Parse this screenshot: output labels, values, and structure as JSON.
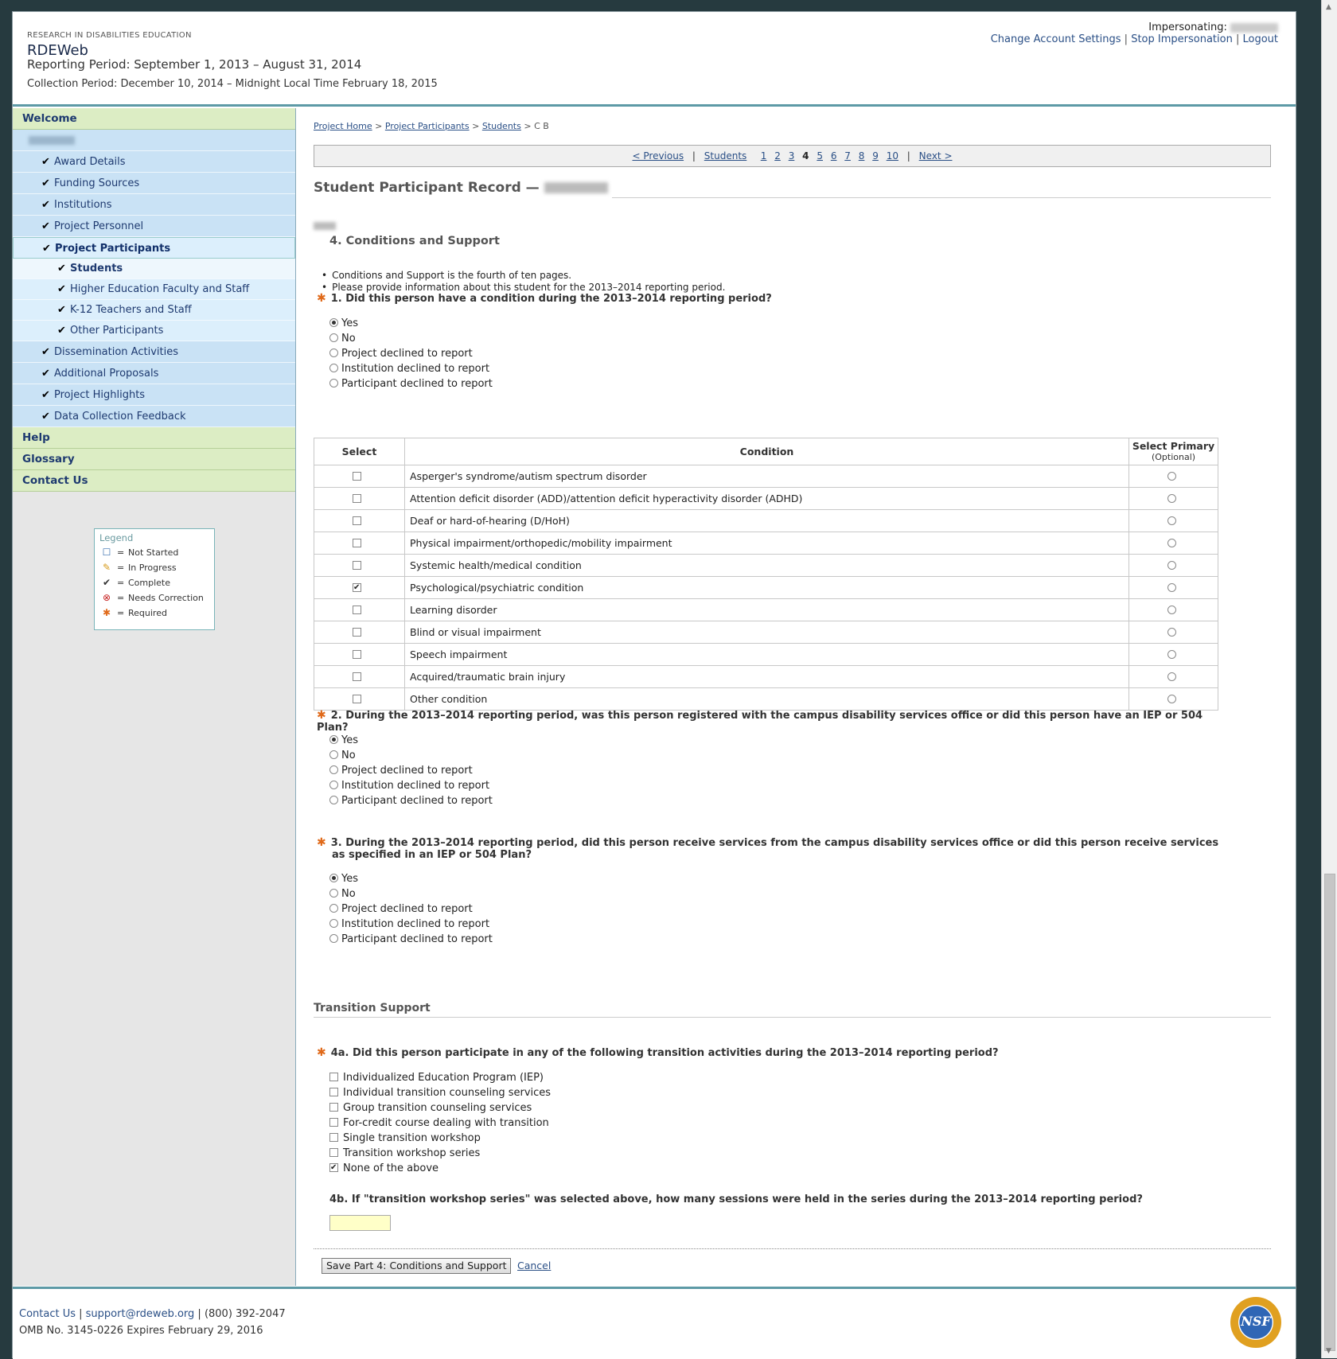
{
  "header": {
    "org": "RESEARCH IN DISABILITIES EDUCATION",
    "app_name": "RDEWeb",
    "reporting_period": "Reporting Period: September 1, 2013 – August 31, 2014",
    "collection_period": "Collection Period: December 10, 2014 – Midnight Local Time February 18, 2015",
    "impersonating_label": "Impersonating:",
    "links": {
      "change_account": "Change Account Settings",
      "stop_impersonation": "Stop Impersonation",
      "logout": "Logout"
    }
  },
  "sidebar": {
    "welcome": "Welcome",
    "items": [
      {
        "label": "Award Details"
      },
      {
        "label": "Funding Sources"
      },
      {
        "label": "Institutions"
      },
      {
        "label": "Project Personnel"
      },
      {
        "label": "Project Participants"
      }
    ],
    "subitems": [
      {
        "label": "Students"
      },
      {
        "label": "Higher Education Faculty and Staff"
      },
      {
        "label": "K-12 Teachers and Staff"
      },
      {
        "label": "Other Participants"
      }
    ],
    "items2": [
      {
        "label": "Dissemination Activities"
      },
      {
        "label": "Additional Proposals"
      },
      {
        "label": "Project Highlights"
      },
      {
        "label": "Data Collection Feedback"
      }
    ],
    "help": "Help",
    "glossary": "Glossary",
    "contact": "Contact Us",
    "check_glyph": "✔"
  },
  "legend": {
    "title": "Legend",
    "eq": "=",
    "not_started": "Not Started",
    "in_progress": "In Progress",
    "complete": "Complete",
    "needs_correction": "Needs Correction",
    "required": "Required"
  },
  "breadcrumb": {
    "home": "Project Home",
    "participants": "Project Participants",
    "students": "Students",
    "current": "C B",
    "sep": ">"
  },
  "pager": {
    "previous": "< Previous",
    "students": "Students",
    "pages": [
      "1",
      "2",
      "3",
      "4",
      "5",
      "6",
      "7",
      "8",
      "9",
      "10"
    ],
    "current_page": "4",
    "next": "Next >",
    "sep": "|"
  },
  "record": {
    "title": "Student Participant Record —",
    "section": "4. Conditions and Support",
    "bullets": [
      "Conditions and Support is the fourth of ten pages.",
      "Please provide information about this student for the 2013–2014 reporting period."
    ]
  },
  "options": {
    "yes": "Yes",
    "no": "No",
    "project_declined": "Project declined to report",
    "institution_declined": "Institution declined to report",
    "participant_declined": "Participant declined to report"
  },
  "q1": {
    "text": "1. Did this person have a condition during the 2013–2014 reporting period?",
    "selected": "Yes"
  },
  "conditions_table": {
    "headers": {
      "select": "Select",
      "condition": "Condition",
      "primary": "Select Primary",
      "primary_sub": "(Optional)"
    },
    "rows": [
      {
        "name": "Asperger's syndrome/autism spectrum disorder",
        "checked": false
      },
      {
        "name": "Attention deficit disorder (ADD)/attention deficit hyperactivity disorder (ADHD)",
        "checked": false
      },
      {
        "name": "Deaf or hard-of-hearing (D/HoH)",
        "checked": false
      },
      {
        "name": "Physical impairment/orthopedic/mobility impairment",
        "checked": false
      },
      {
        "name": "Systemic health/medical condition",
        "checked": false
      },
      {
        "name": "Psychological/psychiatric condition",
        "checked": true
      },
      {
        "name": "Learning disorder",
        "checked": false
      },
      {
        "name": "Blind or visual impairment",
        "checked": false
      },
      {
        "name": "Speech impairment",
        "checked": false
      },
      {
        "name": "Acquired/traumatic brain injury",
        "checked": false
      },
      {
        "name": "Other condition",
        "checked": false
      }
    ]
  },
  "q2": {
    "text": "2. During the 2013–2014 reporting period, was this person registered with the campus disability services office or did this person have an IEP or 504 Plan?",
    "selected": "Yes"
  },
  "q3": {
    "text": "3. During the 2013–2014 reporting period, did this person receive services from the campus disability services office or did this person receive services as specified in an IEP or 504 Plan?",
    "selected": "Yes"
  },
  "transition": {
    "heading": "Transition Support",
    "q4a": "4a. Did this person participate in any of the following transition activities during the 2013–2014 reporting period?",
    "activities": [
      {
        "label": "Individualized Education Program (IEP)",
        "checked": false
      },
      {
        "label": "Individual transition counseling services",
        "checked": false
      },
      {
        "label": "Group transition counseling services",
        "checked": false
      },
      {
        "label": "For-credit course dealing with transition",
        "checked": false
      },
      {
        "label": "Single transition workshop",
        "checked": false
      },
      {
        "label": "Transition workshop series",
        "checked": false
      },
      {
        "label": "None of the above",
        "checked": true
      }
    ],
    "q4b": "4b. If \"transition workshop series\" was selected above, how many sessions were held in the series during the 2013–2014 reporting period?",
    "sessions_value": ""
  },
  "actions": {
    "save": "Save Part 4: Conditions and Support",
    "cancel": "Cancel"
  },
  "footer": {
    "contact": "Contact Us",
    "email": "support@rdeweb.org",
    "phone": "(800) 392-2047",
    "omb": "OMB No. 3145-0226 Expires February 29, 2016",
    "logo_text": "NSF"
  },
  "colors": {
    "accent": "#5d9aa6",
    "nav_green": "#dcedc4",
    "nav_blue": "#c9e2f5",
    "required": "#e06a1a",
    "link": "#2a4f86"
  }
}
